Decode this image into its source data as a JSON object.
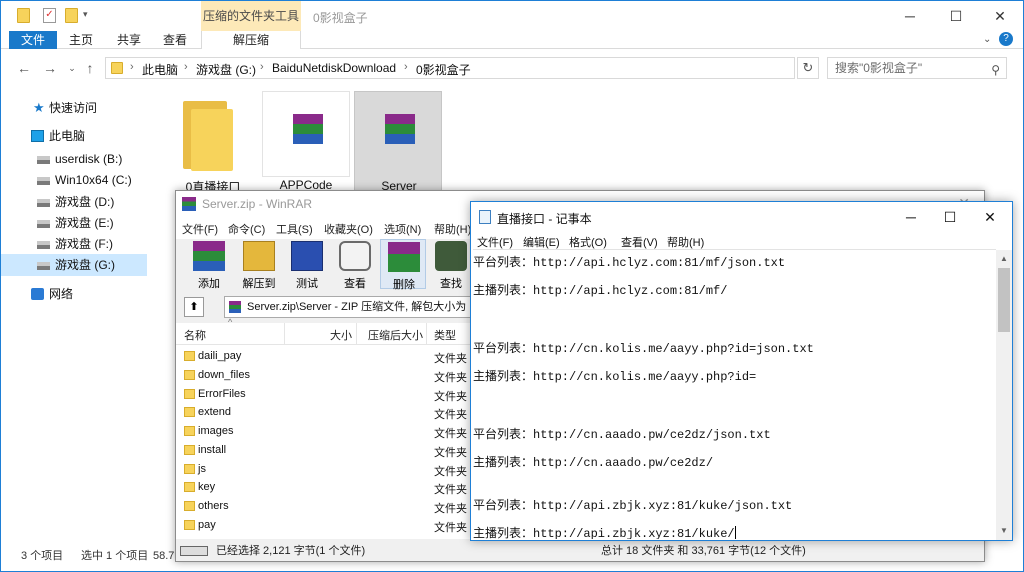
{
  "explorer": {
    "context_tab_title": "压缩的文件夹工具",
    "window_title": "0影视盒子",
    "ribbon_tabs": [
      "文件",
      "主页",
      "共享",
      "查看",
      "解压缩"
    ],
    "breadcrumbs": [
      "此电脑",
      "游戏盘 (G:)",
      "BaiduNetdiskDownload",
      "0影视盒子"
    ],
    "search_placeholder": "搜索\"0影视盒子\"",
    "nav": [
      {
        "label": "快速访问",
        "icon": "star-icon"
      },
      {
        "label": "此电脑",
        "icon": "pc-icon"
      },
      {
        "label": "userdisk (B:)",
        "icon": "drive-icon"
      },
      {
        "label": "Win10x64 (C:)",
        "icon": "drive-icon"
      },
      {
        "label": "游戏盘 (D:)",
        "icon": "drive-icon"
      },
      {
        "label": "游戏盘 (E:)",
        "icon": "drive-icon"
      },
      {
        "label": "游戏盘 (F:)",
        "icon": "drive-icon"
      },
      {
        "label": "游戏盘 (G:)",
        "icon": "drive-icon",
        "selected": true
      },
      {
        "label": "网络",
        "icon": "network-icon"
      }
    ],
    "items": [
      {
        "label": "0直播接口",
        "icon": "folder-icon"
      },
      {
        "label": "APPCode",
        "icon": "winrar-archive-icon"
      },
      {
        "label": "Server",
        "icon": "winrar-archive-icon",
        "selected": true
      }
    ],
    "status": {
      "count": "3 个项目",
      "selected": "选中 1 个项目",
      "size": "58.7"
    }
  },
  "winrar": {
    "title": "Server.zip - WinRAR",
    "menu": [
      "文件(F)",
      "命令(C)",
      "工具(S)",
      "收藏夹(O)",
      "选项(N)",
      "帮助(H)"
    ],
    "tools": [
      {
        "label": "添加",
        "icon": "add-icon"
      },
      {
        "label": "解压到",
        "icon": "extract-to-icon"
      },
      {
        "label": "测试",
        "icon": "test-icon"
      },
      {
        "label": "查看",
        "icon": "view-icon"
      },
      {
        "label": "删除",
        "icon": "delete-icon"
      },
      {
        "label": "查找",
        "icon": "find-icon"
      }
    ],
    "path": "Server.zip\\Server - ZIP 压缩文件, 解包大小为",
    "columns": [
      "名称",
      "大小",
      "压缩后大小",
      "类型"
    ],
    "files": [
      {
        "name": "daili_pay",
        "type": "文件夹"
      },
      {
        "name": "down_files",
        "type": "文件夹"
      },
      {
        "name": "ErrorFiles",
        "type": "文件夹"
      },
      {
        "name": "extend",
        "type": "文件夹"
      },
      {
        "name": "images",
        "type": "文件夹"
      },
      {
        "name": "install",
        "type": "文件夹"
      },
      {
        "name": "js",
        "type": "文件夹"
      },
      {
        "name": "key",
        "type": "文件夹"
      },
      {
        "name": "others",
        "type": "文件夹"
      },
      {
        "name": "pay",
        "type": "文件夹"
      }
    ],
    "status_left": "已经选择 2,121 字节(1 个文件)",
    "status_right": "总计 18 文件夹 和 33,761 字节(12 个文件)"
  },
  "notepad": {
    "title": "直播接口 - 记事本",
    "menu": [
      "文件(F)",
      "编辑(E)",
      "格式(O)",
      "查看(V)",
      "帮助(H)"
    ],
    "lines": [
      "平台列表：http://api.hclyz.com:81/mf/json.txt",
      "主播列表：http://api.hclyz.com:81/mf/",
      "平台列表：http://cn.kolis.me/aayy.php?id=json.txt",
      "主播列表：http://cn.kolis.me/aayy.php?id=",
      "平台列表：http://cn.aaado.pw/ce2dz/json.txt",
      "主播列表：http://cn.aaado.pw/ce2dz/",
      "平台列表：http://api.zbjk.xyz:81/kuke/json.txt",
      "主播列表：http://api.zbjk.xyz:81/kuke/"
    ]
  }
}
